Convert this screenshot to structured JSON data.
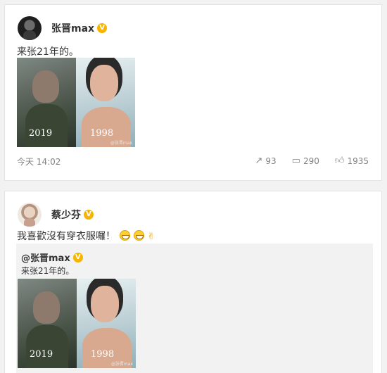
{
  "post1": {
    "username": "张晋max",
    "verified_icon": "verified-badge-icon",
    "text": "来张21年的。",
    "photo": {
      "year_left": "2019",
      "year_right": "1998",
      "watermark": "@张晋max"
    },
    "time": "今天 14:02",
    "actions": {
      "repost": "93",
      "comment": "290",
      "like": "1935"
    }
  },
  "post2": {
    "username": "蔡少芬",
    "verified_icon": "verified-badge-icon",
    "text": "我喜歡沒有穿衣服囉！",
    "emojis": [
      "grin-emoji",
      "grin-emoji",
      "rock-hand-emoji"
    ],
    "quote": {
      "username": "@张晋max",
      "text": "来张21年的。",
      "photo": {
        "year_left": "2019",
        "year_right": "1998",
        "watermark": "@张晋max"
      }
    }
  },
  "colors": {
    "verified": "#f7b500",
    "card_bg": "#ffffff",
    "page_bg": "#f2f2f2",
    "quote_bg": "#f2f2f2"
  }
}
